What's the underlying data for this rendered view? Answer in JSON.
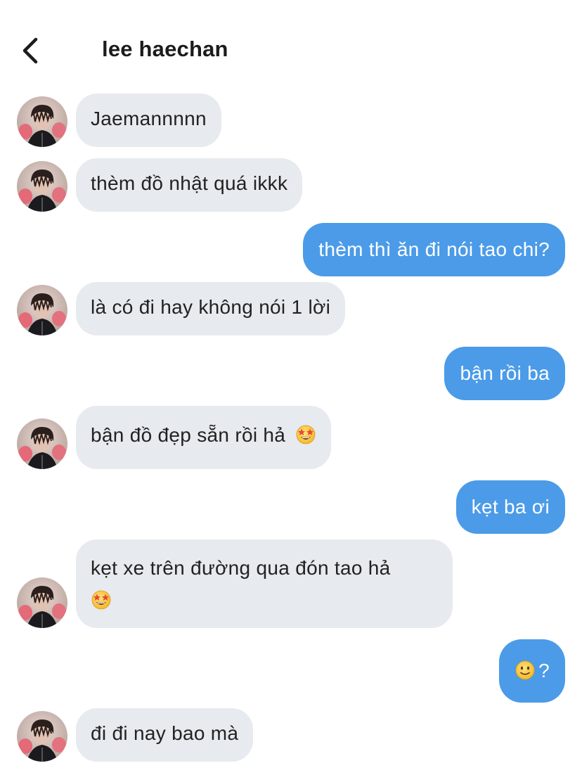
{
  "header": {
    "back_icon": "chevron-left-icon",
    "contact_name": "lee haechan"
  },
  "messages": [
    {
      "from": "contact",
      "text": "Jaemannnnn"
    },
    {
      "from": "contact",
      "text": "thèm đồ nhật quá ikkk"
    },
    {
      "from": "me",
      "text": "thèm thì ăn đi nói tao chi?"
    },
    {
      "from": "contact",
      "text": "là có đi hay không nói 1 lời"
    },
    {
      "from": "me",
      "text": "bận rồi ba"
    },
    {
      "from": "contact",
      "text": "bận đồ đẹp sẵn rồi hả",
      "emoji": "star-struck-emoji-icon"
    },
    {
      "from": "me",
      "text": "kẹt ba ơi"
    },
    {
      "from": "contact",
      "text": "kẹt xe trên đường qua đón tao hả",
      "emoji": "star-struck-emoji-icon"
    },
    {
      "from": "me",
      "text": "?",
      "emoji": "slightly-smiling-emoji-icon"
    },
    {
      "from": "contact",
      "text": "đi đi nay bao mà"
    }
  ],
  "colors": {
    "incoming_bubble": "#e7eaee",
    "outgoing_bubble": "#4b9be8",
    "incoming_text": "#222222",
    "outgoing_text": "#ffffff"
  }
}
